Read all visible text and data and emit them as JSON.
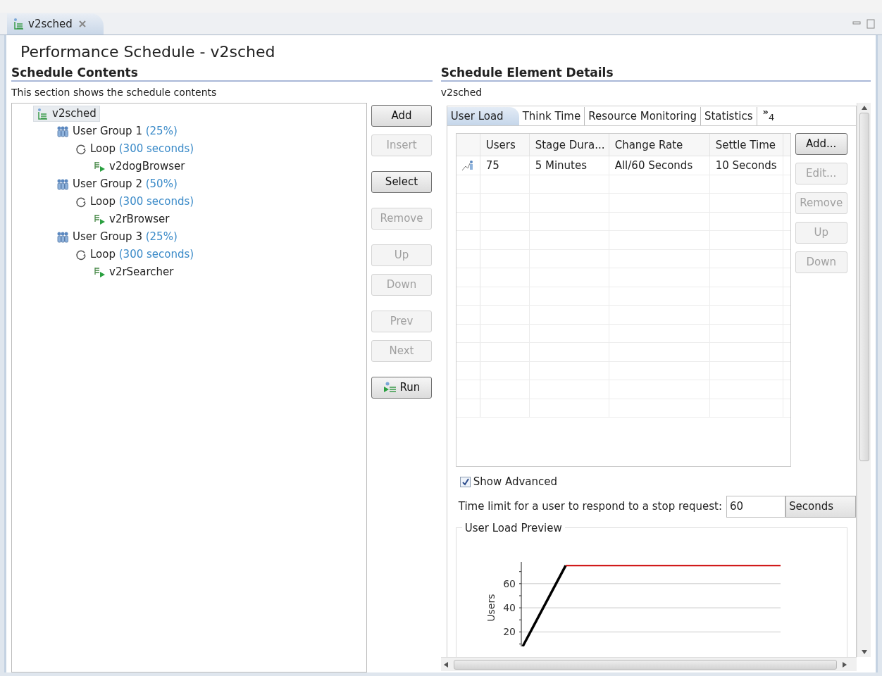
{
  "editor_tab": {
    "label": "v2sched",
    "selected": true
  },
  "title": "Performance Schedule - v2sched",
  "contents": {
    "heading": "Schedule Contents",
    "description": "This section shows the schedule contents",
    "tree": [
      {
        "kind": "schedule",
        "label": "v2sched",
        "selected": true,
        "children": [
          {
            "kind": "group",
            "label": "User Group 1",
            "detail": "(25%)",
            "selected": false,
            "children": [
              {
                "kind": "loop",
                "label": "Loop",
                "detail": "(300 seconds)",
                "selected": false,
                "children": [
                  {
                    "kind": "test",
                    "label": "v2dogBrowser",
                    "selected": false
                  }
                ]
              }
            ]
          },
          {
            "kind": "group",
            "label": "User Group 2",
            "detail": "(50%)",
            "selected": false,
            "children": [
              {
                "kind": "loop",
                "label": "Loop",
                "detail": "(300 seconds)",
                "selected": false,
                "children": [
                  {
                    "kind": "test",
                    "label": "v2rBrowser",
                    "selected": false
                  }
                ]
              }
            ]
          },
          {
            "kind": "group",
            "label": "User Group 3",
            "detail": "(25%)",
            "selected": false,
            "children": [
              {
                "kind": "loop",
                "label": "Loop",
                "detail": "(300 seconds)",
                "selected": false,
                "children": [
                  {
                    "kind": "test",
                    "label": "v2rSearcher",
                    "selected": false
                  }
                ]
              }
            ]
          }
        ]
      }
    ],
    "buttons": [
      {
        "label": "Add",
        "disabled": false
      },
      {
        "label": "Insert",
        "disabled": true
      },
      {
        "label": "Select",
        "disabled": false
      },
      {
        "label": "Remove",
        "disabled": true
      },
      {
        "label": "Up",
        "disabled": true
      },
      {
        "label": "Down",
        "disabled": true
      },
      {
        "label": "Prev",
        "disabled": true
      },
      {
        "label": "Next",
        "disabled": true
      },
      {
        "label": "Run",
        "disabled": false,
        "kind": "run"
      }
    ]
  },
  "details": {
    "heading": "Schedule Element Details",
    "subtitle": "v2sched",
    "tabs": [
      {
        "label": "User Load",
        "selected": true
      },
      {
        "label": "Think Time",
        "selected": false
      },
      {
        "label": "Resource Monitoring",
        "selected": false
      },
      {
        "label": "Statistics",
        "selected": false
      }
    ],
    "overflow": {
      "symbol": "»",
      "count": "4"
    },
    "table": {
      "columns": [
        "Users",
        "Stage Dura...",
        "Change Rate",
        "Settle Time"
      ],
      "rows": [
        {
          "cells": [
            "75",
            "5 Minutes",
            "All/60 Seconds",
            "10 Seconds"
          ]
        }
      ]
    },
    "table_buttons": [
      {
        "label": "Add...",
        "disabled": false
      },
      {
        "label": "Edit...",
        "disabled": true
      },
      {
        "label": "Remove",
        "disabled": true
      },
      {
        "label": "Up",
        "disabled": true
      },
      {
        "label": "Down",
        "disabled": true
      }
    ],
    "show_advanced": {
      "label": "Show Advanced",
      "checked": true
    },
    "stop_limit": {
      "label": "Time limit for a user to respond to a stop request:",
      "value": "60",
      "unit": "Seconds"
    },
    "preview": {
      "title": "User Load Preview",
      "chart_data": {
        "type": "line",
        "ylabel": "Users",
        "grid": true,
        "ylim": [
          8,
          78
        ],
        "yticks": [
          20,
          40,
          60
        ],
        "series": [
          {
            "color": "#000000",
            "values": [
              8,
              75,
              null,
              null,
              null,
              null,
              null
            ]
          },
          {
            "color": "#cc0000",
            "values": [
              null,
              75,
              75,
              75,
              75,
              75,
              75
            ]
          }
        ]
      }
    }
  }
}
